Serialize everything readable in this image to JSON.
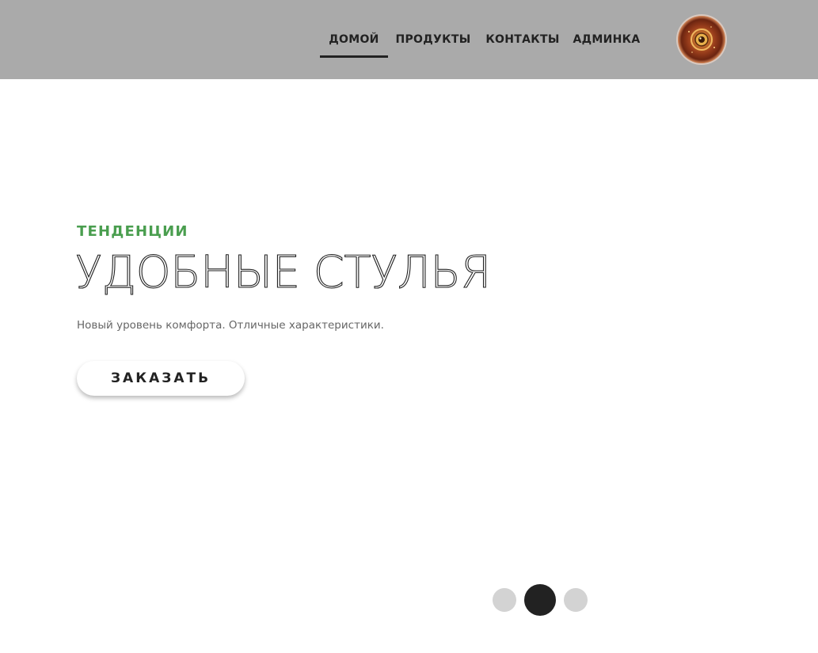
{
  "header": {
    "background": "#aaaaaa",
    "nav": [
      {
        "label": "ДОМОЙ",
        "active": true
      },
      {
        "label": "ПРОДУКТЫ",
        "active": false
      },
      {
        "label": "КОНТАКТЫ",
        "active": false
      },
      {
        "label": "АДМИНКА",
        "active": false
      }
    ],
    "avatar_icon": "user-avatar"
  },
  "hero": {
    "eyebrow": "ТЕНДЕНЦИИ",
    "title": "УДОБНЫЕ СТУЛЬЯ",
    "subtitle": "Новый уровень комфорта. Отличные характеристики.",
    "cta_label": "ЗАКАЗАТЬ",
    "accent_color": "#4a9e4f"
  },
  "slider": {
    "total": 3,
    "active_index": 2
  }
}
